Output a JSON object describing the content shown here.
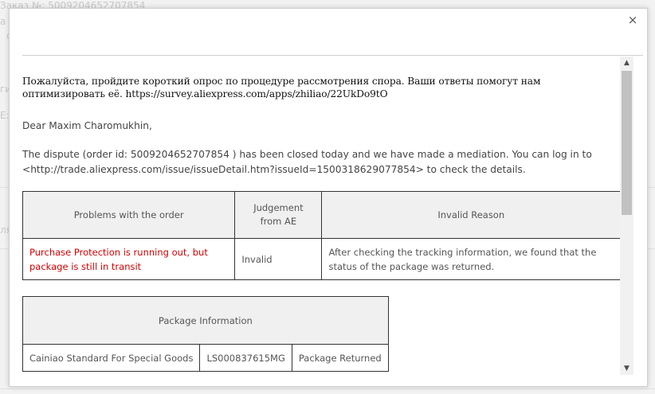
{
  "background": {
    "order_text": "Заказ №: 5009204652707854",
    "frag_1": "а",
    "frag_2": "с",
    "frag_3": "ги",
    "frag_4": "E:",
    "frag_5": "ля"
  },
  "modal": {
    "close_symbol": "×",
    "survey_text": "Пожалуйста, пройдите короткий опрос по процедуре рассмотрения спора. Ваши ответы помогут нам оптимизировать её. https://survey.aliexpress.com/apps/zhiliao/22UkDo9tO",
    "greeting": "Dear Maxim Charomukhin,",
    "dispute_text": "The dispute (order id: 5009204652707854 ) has been closed today and we have made a mediation. You can log in to <http://trade.aliexpress.com/issue/issueDetail.htm?issueId=1500318629077854> to check the details.",
    "judgement_table": {
      "headers": [
        "Problems with the order",
        "Judgement from AE",
        "Invalid Reason"
      ],
      "rows": [
        {
          "problem": "Purchase Protection is running out, but package is still in transit",
          "judgement": "Invalid",
          "reason": "After checking the tracking information, we found that the status of the package was returned."
        }
      ]
    },
    "package_table": {
      "header": "Package Information",
      "rows": [
        {
          "carrier": "Cainiao Standard For Special Goods",
          "tracking": "LS000837615MG",
          "status": "Package Returned"
        }
      ]
    }
  },
  "scrollbar": {
    "up_arrow": "▲",
    "down_arrow": "▼"
  },
  "colors": {
    "problem_text": "#d40000",
    "table_header_bg": "#f0f0f0",
    "scroll_thumb": "#c1c1c1"
  }
}
